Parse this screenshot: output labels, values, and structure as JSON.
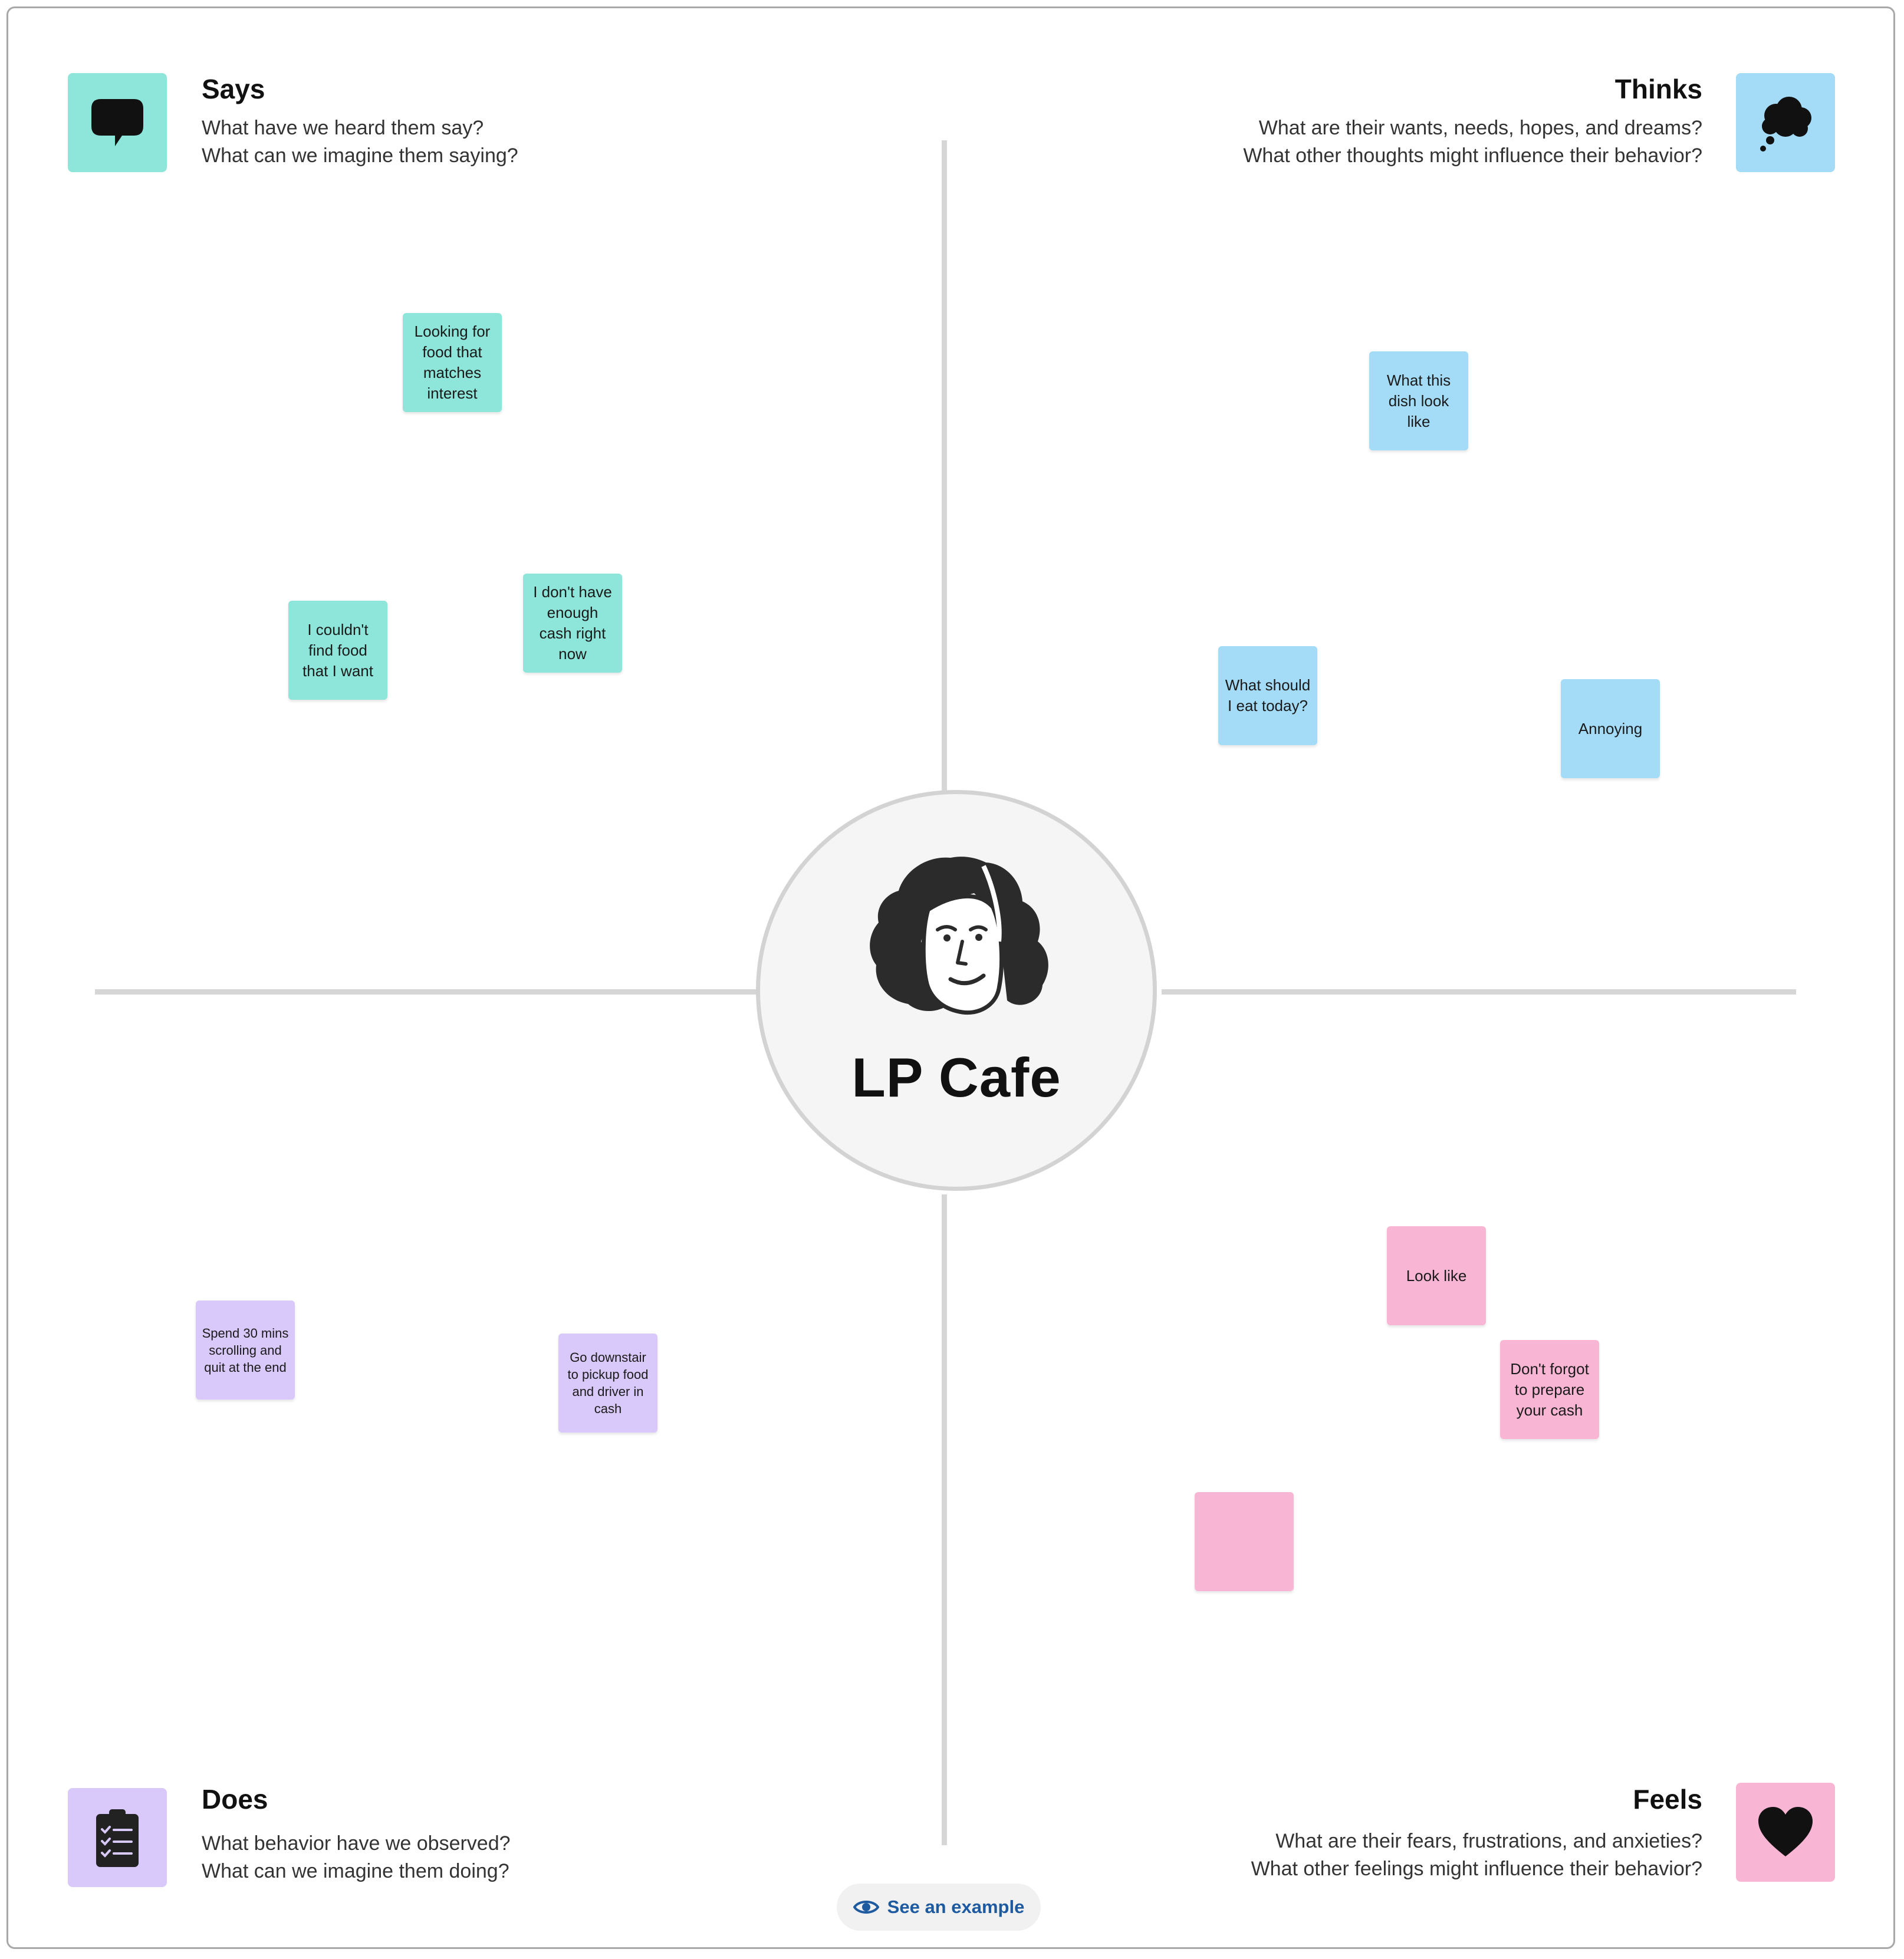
{
  "colors": {
    "says": "#8de6d9",
    "thinks": "#a4dcf7",
    "feels": "#f9b6d4",
    "does": "#d9c8fa",
    "axis": "#d6d6d6",
    "link": "#1e5aa0"
  },
  "persona": {
    "name": "LP Cafe",
    "icon": "person-face-icon"
  },
  "quadrants": {
    "says": {
      "title": "Says",
      "line1": "What have we heard them say?",
      "line2": "What can we imagine them saying?",
      "icon": "speech-bubble-icon"
    },
    "thinks": {
      "title": "Thinks",
      "line1": "What are their wants, needs, hopes, and dreams?",
      "line2": "What other thoughts might influence their behavior?",
      "icon": "thought-cloud-icon"
    },
    "does": {
      "title": "Does",
      "line1": "What behavior have we observed?",
      "line2": "What can we imagine them doing?",
      "icon": "clipboard-checklist-icon"
    },
    "feels": {
      "title": "Feels",
      "line1": "What are their fears, frustrations, and anxieties?",
      "line2": "What other feelings might influence their behavior?",
      "icon": "heart-icon"
    }
  },
  "notes": {
    "says": [
      "Looking for food that matches interest",
      "I couldn't find food that I want",
      "I don't have enough cash right now"
    ],
    "thinks": [
      "What this dish look like",
      "What should I eat today?",
      "Annoying"
    ],
    "feels": [
      "Look like",
      "Don't forgot to prepare your cash",
      ""
    ],
    "does": [
      "Spend 30 mins scrolling and quit at the end",
      "Go downstair to pickup food and driver in cash"
    ]
  },
  "footer": {
    "example_label": "See an example",
    "example_icon": "eye-icon"
  }
}
